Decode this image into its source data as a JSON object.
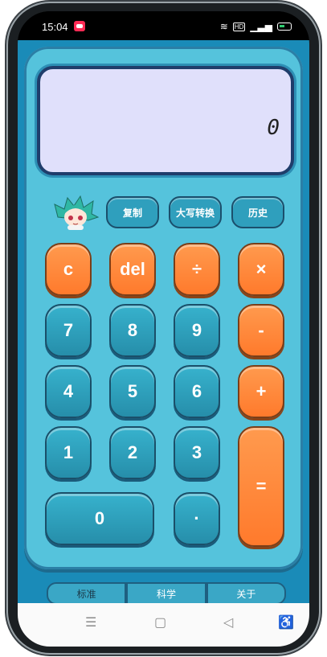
{
  "status_bar": {
    "time": "15:04",
    "wifi_icon": "wifi-icon",
    "hd_label": "HD",
    "signal_icon": "signal-icon",
    "battery_icon": "battery-icon"
  },
  "display": {
    "value": "0"
  },
  "function_buttons": [
    {
      "label": "复制"
    },
    {
      "label": "大写转换"
    },
    {
      "label": "历史"
    }
  ],
  "keys": {
    "clear": "c",
    "del": "del",
    "divide": "÷",
    "multiply": "×",
    "seven": "7",
    "eight": "8",
    "nine": "9",
    "minus": "-",
    "four": "4",
    "five": "5",
    "six": "6",
    "plus": "+",
    "one": "1",
    "two": "2",
    "three": "3",
    "equals": "=",
    "zero": "0",
    "dot": "·"
  },
  "tabs": [
    {
      "label": "标准"
    },
    {
      "label": "科学"
    },
    {
      "label": "关于"
    }
  ],
  "nav": {
    "menu_glyph": "☰",
    "home_glyph": "▢",
    "back_glyph": "◁",
    "accessibility_glyph": "♿"
  },
  "colors": {
    "calc_body": "#55c3dc",
    "number_key": "#2a9ab8",
    "operator_key": "#ff8a3a",
    "display_bg": "#e0e0fb"
  }
}
